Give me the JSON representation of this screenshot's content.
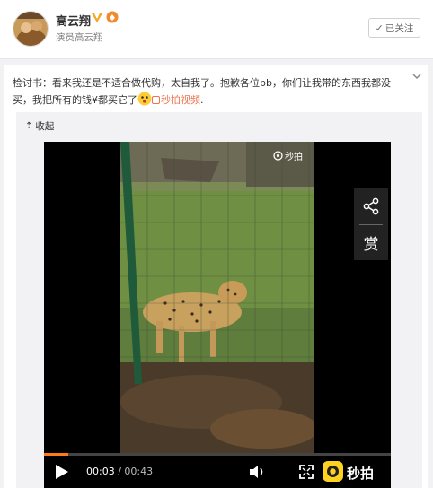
{
  "header": {
    "user_name": "高云翔",
    "user_desc": "演员高云翔",
    "follow_label": "已关注",
    "icons": [
      "avatar",
      "verified-icon",
      "rank-icon",
      "check-icon"
    ]
  },
  "post": {
    "text_main": "检讨书：看来我还是不适合做代购，太自我了。抱歉各位bb，你们让我带的东西我都没买，我把所有的钱¥都买它了",
    "link_label": "秒拍视频",
    "trailing": ".",
    "icons": [
      "more-chevron-icon",
      "emoji-icon",
      "video-link-icon"
    ]
  },
  "media": {
    "collapse_label": "收起",
    "watermark_label": "秒拍",
    "reward_label": "赏",
    "time_current": "00:03",
    "time_separator": " / ",
    "time_total": "00:43",
    "brand_name": "秒拍",
    "progress_fraction": 0.07,
    "accent_color": "#ff7a1a",
    "link_color": "#eb7350",
    "icons": [
      "collapse-arrow-icon",
      "share-icon",
      "play-icon",
      "volume-icon",
      "fullscreen-icon",
      "miaopai-logo-icon"
    ]
  }
}
